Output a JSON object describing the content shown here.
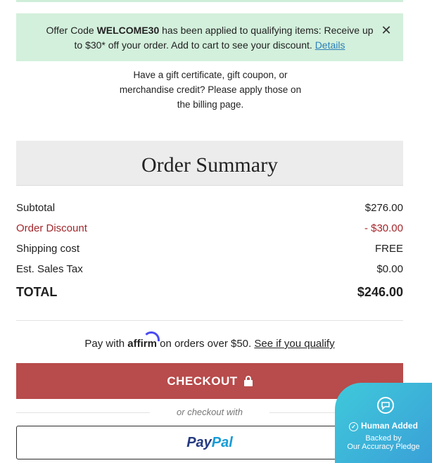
{
  "promo": {
    "prefix": "Offer Code ",
    "code": "WELCOME30",
    "message": " has been applied to qualifying items: Receive up to $30* off your order. Add to cart to see your discount. ",
    "link": "Details",
    "close_glyph": "✕"
  },
  "gift_note": "Have a gift certificate, gift coupon, or merchandise credit? Please apply those on the billing page.",
  "summary": {
    "title": "Order Summary",
    "rows": [
      {
        "label": "Subtotal",
        "value": "$276.00"
      },
      {
        "label": "Order Discount",
        "value": "- $30.00"
      },
      {
        "label": "Shipping cost",
        "value": "FREE"
      },
      {
        "label": "Est. Sales Tax",
        "value": "$0.00"
      }
    ],
    "total_label": "TOTAL",
    "total_value": "$246.00"
  },
  "affirm": {
    "prefix": "Pay with ",
    "logo_text": "affirm",
    "suffix": " on orders over $50. ",
    "link": "See if you qualify"
  },
  "checkout": {
    "label": "CHECKOUT"
  },
  "alt_checkout": "or checkout with",
  "paypal": {
    "pay": "Pay",
    "pal": "Pal"
  },
  "badge": {
    "title": "Human Added",
    "line1": "Backed by",
    "line2": "Our Accuracy Pledge"
  },
  "colors": {
    "promo_bg": "#d3f0dc",
    "discount_red": "#a3262b",
    "checkout_bg": "#b84b4b",
    "affirm_blue": "#4a4af4",
    "paypal_dark": "#253b80",
    "paypal_light": "#179bd7"
  }
}
